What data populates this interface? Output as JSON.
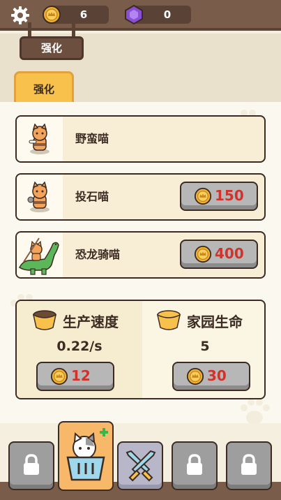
{
  "topbar": {
    "coins": "6",
    "gems": "0",
    "settings_icon": "gear-icon",
    "coin_icon": "coin-icon",
    "gem_icon": "purple-gem-icon"
  },
  "sign": {
    "title": "强化"
  },
  "tabs": [
    {
      "label": "强化",
      "active": true
    }
  ],
  "units": [
    {
      "name": "野蛮喵",
      "icon": "barbarian-cat-icon",
      "price": null
    },
    {
      "name": "投石喵",
      "icon": "stone-thrower-cat-icon",
      "price": "150"
    },
    {
      "name": "恐龙骑喵",
      "icon": "dino-rider-cat-icon",
      "price": "400"
    }
  ],
  "stats": {
    "production": {
      "title": "生产速度",
      "value": "0.22/s",
      "price": "12"
    },
    "home_life": {
      "title": "家园生命",
      "value": "5",
      "price": "30"
    }
  },
  "dock": {
    "slots": [
      {
        "icon": "lock-icon"
      },
      {
        "icon": "cat-basket-icon",
        "active": true
      },
      {
        "icon": "crossed-swords-icon"
      },
      {
        "icon": "lock-icon"
      },
      {
        "icon": "lock-icon"
      }
    ]
  },
  "colors": {
    "accent": "#f7c14b",
    "price_red": "#d0332c",
    "wood": "#7a5c4b"
  }
}
